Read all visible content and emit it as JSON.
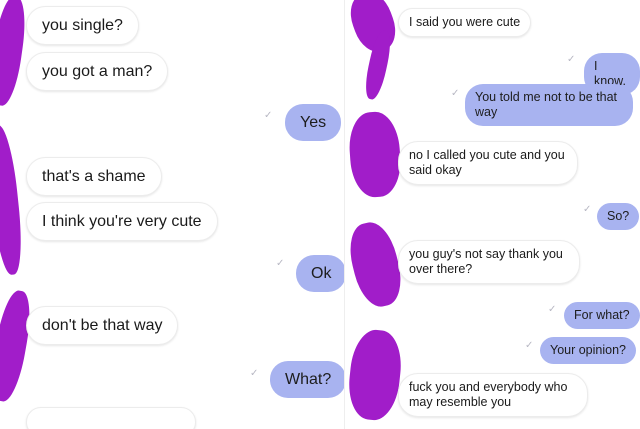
{
  "colors": {
    "sent_bubble": "#a8b3f0",
    "received_bubble": "#ffffff",
    "redaction_scribble": "#a11dc9",
    "seen_receipt": "#b8b8c4"
  },
  "icons": {
    "seen_receipt": "seen-checkmark-icon"
  },
  "left_panel": {
    "messages": [
      {
        "from": "them",
        "text": "you single?"
      },
      {
        "from": "them",
        "text": "you got a man?"
      },
      {
        "from": "me",
        "text": "Yes"
      },
      {
        "from": "them",
        "text": "that's a shame"
      },
      {
        "from": "them",
        "text": "I think you're very cute"
      },
      {
        "from": "me",
        "text": "Ok"
      },
      {
        "from": "them",
        "text": "don't be that way"
      },
      {
        "from": "me",
        "text": "What?"
      }
    ]
  },
  "right_panel": {
    "messages": [
      {
        "from": "them",
        "text": "I said you were cute"
      },
      {
        "from": "me",
        "text": "I know."
      },
      {
        "from": "me",
        "text": "You told me not to be that way"
      },
      {
        "from": "them",
        "text": "no I called you cute and you said okay"
      },
      {
        "from": "me",
        "text": "So?"
      },
      {
        "from": "them",
        "text": "you guy's not say thank you over there?"
      },
      {
        "from": "me",
        "text": "For what?"
      },
      {
        "from": "me",
        "text": "Your opinion?"
      },
      {
        "from": "them",
        "text": "fuck you and everybody who may resemble you"
      }
    ]
  }
}
